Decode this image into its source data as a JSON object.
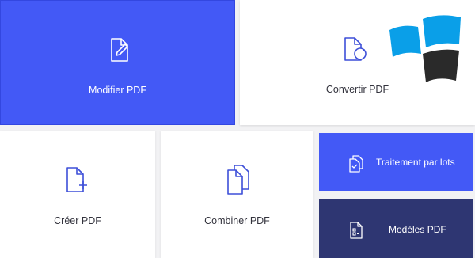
{
  "tiles": {
    "modifier": {
      "label": "Modifier PDF",
      "icon": "edit-pdf-icon"
    },
    "convertir": {
      "label": "Convertir PDF",
      "icon": "convert-pdf-icon"
    },
    "creer": {
      "label": "Créer PDF",
      "icon": "create-pdf-icon"
    },
    "combiner": {
      "label": "Combiner PDF",
      "icon": "combine-pdf-icon"
    },
    "lots": {
      "label": "Traitement par lots",
      "icon": "batch-process-icon"
    },
    "modeles": {
      "label": "Modèles PDF",
      "icon": "pdf-templates-icon"
    }
  },
  "colors": {
    "primary_blue": "#4359f6",
    "dark_navy": "#2e3672",
    "icon_blue": "#3d4fd8",
    "logo_blue": "#0a9fe8",
    "logo_dark": "#2a2a2a"
  },
  "watermark_logo": "windows-logo-icon"
}
